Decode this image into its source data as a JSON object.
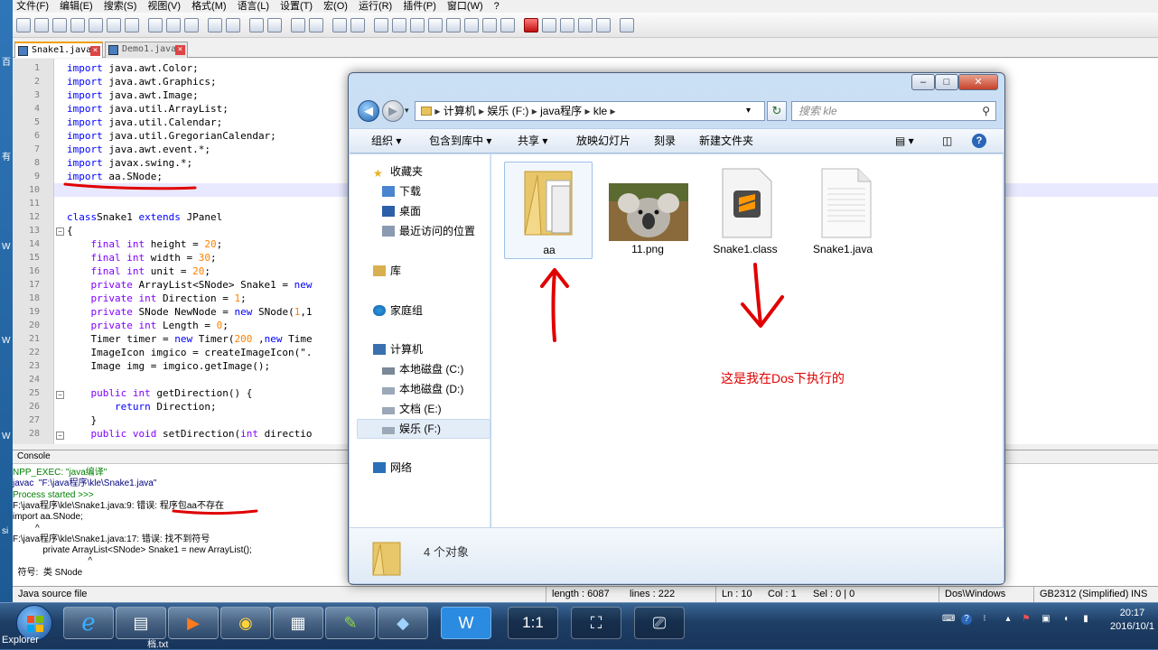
{
  "menubar": [
    "文件(F)",
    "编辑(E)",
    "搜索(S)",
    "视图(V)",
    "格式(M)",
    "语言(L)",
    "设置(T)",
    "宏(O)",
    "运行(R)",
    "插件(P)",
    "窗口(W)",
    "?"
  ],
  "tabs": [
    {
      "label": "Snake1.java",
      "active": true
    },
    {
      "label": "Demo1.java",
      "active": false
    }
  ],
  "desktop_side": [
    "百",
    "有",
    "W",
    "W",
    "W",
    "si",
    "Ir"
  ],
  "editor": {
    "line_numbers": [
      "1",
      "2",
      "3",
      "4",
      "5",
      "6",
      "7",
      "8",
      "9",
      "10",
      "11",
      "12",
      "13",
      "14",
      "15",
      "16",
      "17",
      "18",
      "19",
      "20",
      "21",
      "22",
      "23",
      "24",
      "25",
      "26",
      "27",
      "28"
    ],
    "lines": [
      [
        [
          "kw",
          "import"
        ],
        [
          "",
          "java.awt.Color;"
        ]
      ],
      [
        [
          "kw",
          "import"
        ],
        [
          "",
          "java.awt.Graphics;"
        ]
      ],
      [
        [
          "kw",
          "import"
        ],
        [
          "",
          "java.awt.Image;"
        ]
      ],
      [
        [
          "kw",
          "import"
        ],
        [
          "",
          "java.util.ArrayList;"
        ]
      ],
      [
        [
          "kw",
          "import"
        ],
        [
          "",
          "java.util.Calendar;"
        ]
      ],
      [
        [
          "kw",
          "import"
        ],
        [
          "",
          "java.util.GregorianCalendar;"
        ]
      ],
      [
        [
          "kw",
          "import"
        ],
        [
          "",
          "java.awt.event.*;"
        ]
      ],
      [
        [
          "kw",
          "import"
        ],
        [
          "",
          "javax.swing.*;"
        ]
      ],
      [
        [
          "kw",
          "import"
        ],
        [
          "",
          "aa.SNode;"
        ]
      ],
      [],
      [],
      [
        [
          "kw",
          "class"
        ],
        [
          "",
          "Snake1 "
        ],
        [
          "kw",
          "extends"
        ],
        [
          "",
          " JPanel"
        ]
      ],
      [
        [
          "",
          "{"
        ]
      ],
      [
        [
          "",
          "    "
        ],
        [
          "kw2",
          "final int"
        ],
        [
          "",
          " height = "
        ],
        [
          "num",
          "20"
        ],
        [
          "",
          ";"
        ]
      ],
      [
        [
          "",
          "    "
        ],
        [
          "kw2",
          "final int"
        ],
        [
          "",
          " width = "
        ],
        [
          "num",
          "30"
        ],
        [
          "",
          ";"
        ]
      ],
      [
        [
          "",
          "    "
        ],
        [
          "kw2",
          "final int"
        ],
        [
          "",
          " unit = "
        ],
        [
          "num",
          "20"
        ],
        [
          "",
          ";"
        ]
      ],
      [
        [
          "",
          "    "
        ],
        [
          "kw2",
          "private"
        ],
        [
          "",
          " ArrayList<SNode> Snake1 = "
        ],
        [
          "kw",
          "new"
        ]
      ],
      [
        [
          "",
          "    "
        ],
        [
          "kw2",
          "private int"
        ],
        [
          "",
          " Direction = "
        ],
        [
          "num",
          "1"
        ],
        [
          "",
          ";"
        ]
      ],
      [
        [
          "",
          "    "
        ],
        [
          "kw2",
          "private"
        ],
        [
          "",
          " SNode NewNode = "
        ],
        [
          "kw",
          "new"
        ],
        [
          "",
          " SNode("
        ],
        [
          "num",
          "1"
        ],
        [
          "",
          ",1"
        ]
      ],
      [
        [
          "",
          "    "
        ],
        [
          "kw2",
          "private int"
        ],
        [
          "",
          " Length = "
        ],
        [
          "num",
          "0"
        ],
        [
          "",
          ";"
        ]
      ],
      [
        [
          "",
          "    Timer timer = "
        ],
        [
          "kw",
          "new"
        ],
        [
          "",
          " Timer("
        ],
        [
          "num",
          "200"
        ],
        [
          "",
          " ,"
        ],
        [
          "kw",
          "new"
        ],
        [
          "",
          " Time"
        ]
      ],
      [
        [
          "",
          "    ImageIcon imgico = createImageIcon(\"."
        ]
      ],
      [
        [
          "",
          "    Image img = imgico.getImage();"
        ]
      ],
      [],
      [
        [
          "",
          "    "
        ],
        [
          "kw2",
          "public int"
        ],
        [
          "",
          " getDirection() {"
        ]
      ],
      [
        [
          "",
          "        "
        ],
        [
          "kw",
          "return"
        ],
        [
          "",
          " Direction;"
        ]
      ],
      [
        [
          "",
          "    }"
        ]
      ],
      [
        [
          "",
          "    "
        ],
        [
          "kw2",
          "public void"
        ],
        [
          "",
          " setDirection("
        ],
        [
          "kw2",
          "int"
        ],
        [
          "",
          " directio"
        ]
      ]
    ]
  },
  "console": {
    "title": "Console",
    "lines": [
      {
        "t": "NPP_EXEC: \"java编译\"",
        "c": "g"
      },
      {
        "t": "javac  \"F:\\java程序\\kle\\Snake1.java\"",
        "c": "b"
      },
      {
        "t": "Process started >>>",
        "c": "g"
      },
      {
        "t": "F:\\java程序\\kle\\Snake1.java:9: 错误: 程序包aa不存在",
        "c": ""
      },
      {
        "t": "import aa.SNode;",
        "c": ""
      },
      {
        "t": "         ^",
        "c": ""
      },
      {
        "t": "F:\\java程序\\kle\\Snake1.java:17: 错误: 找不到符号",
        "c": ""
      },
      {
        "t": "            private ArrayList<SNode> Snake1 = new ArrayList();",
        "c": ""
      },
      {
        "t": "                              ^",
        "c": ""
      },
      {
        "t": "  符号:  类 SNode",
        "c": ""
      }
    ]
  },
  "status": {
    "type": "Java source file",
    "length": "length : 6087",
    "lines": "lines : 222",
    "ln": "Ln : 10",
    "col": "Col : 1",
    "sel": "Sel : 0 | 0",
    "eol": "Dos\\Windows",
    "enc": "GB2312 (Simplified)",
    "mode": "INS"
  },
  "explorer": {
    "address": [
      "计算机",
      "娱乐 (F:)",
      "java程序",
      "kle"
    ],
    "search_placeholder": "搜索 kle",
    "commands": [
      "组织 ▾",
      "包含到库中 ▾",
      "共享 ▾",
      "放映幻灯片",
      "刻录",
      "新建文件夹"
    ],
    "nav": {
      "favorites": "收藏夹",
      "fav_items": [
        "下载",
        "桌面",
        "最近访问的位置"
      ],
      "library": "库",
      "homegroup": "家庭组",
      "computer": "计算机",
      "drives": [
        "本地磁盘 (C:)",
        "本地磁盘 (D:)",
        "文档 (E:)",
        "娱乐 (F:)"
      ],
      "network": "网络"
    },
    "files": [
      "aa",
      "11.png",
      "Snake1.class",
      "Snake1.java"
    ],
    "status_count": "4 个对象",
    "annotation": "这是我在Dos下执行的"
  },
  "taskbar": {
    "time": "20:17",
    "date": "2016/10/1",
    "explorer_label": "Explorer",
    "txt_label": "档.txt",
    "items": [
      "start",
      "ie",
      "explorer",
      "media",
      "chrome",
      "calc",
      "notepad",
      "vm",
      "wps",
      "ratio",
      "fullscreen",
      "screenshot"
    ],
    "ratio_label": "1:1"
  },
  "colors": {
    "annotation": "#e00000",
    "keyword": "#0000ff",
    "type": "#8000ff",
    "number": "#ff8000"
  }
}
